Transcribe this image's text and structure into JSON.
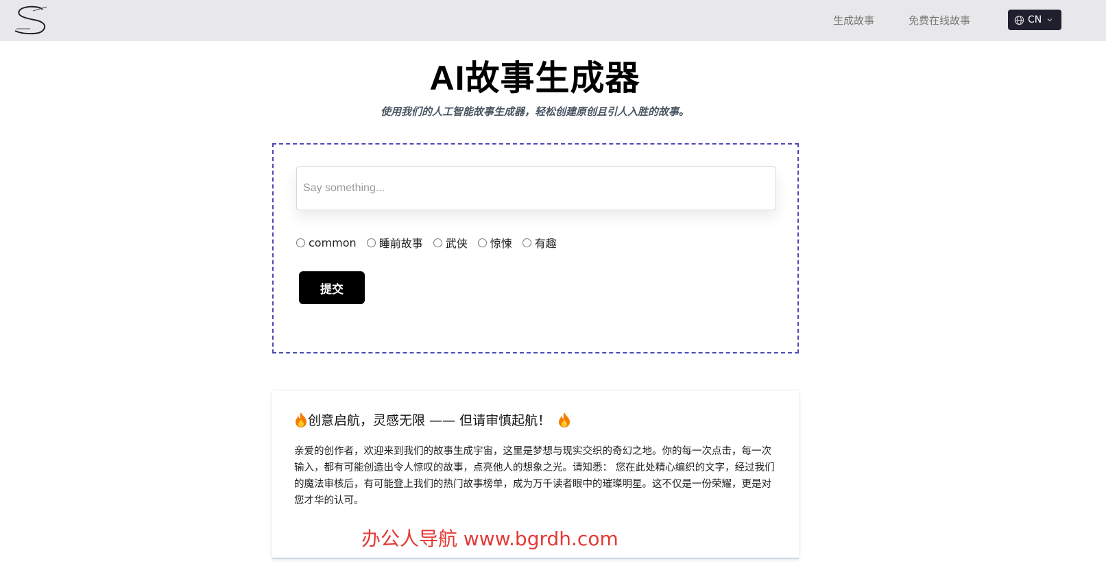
{
  "header": {
    "nav": [
      "生成故事",
      "免费在线故事"
    ],
    "language": "CN"
  },
  "hero": {
    "title": "AI故事生成器",
    "subtitle": "使用我们的人工智能故事生成器，轻松创建原创且引人入胜的故事。"
  },
  "form": {
    "placeholder": "Say something...",
    "value": "",
    "categories": [
      "common",
      "睡前故事",
      "武侠",
      "惊悚",
      "有趣"
    ],
    "submit_label": "提交"
  },
  "notice": {
    "heading": "创意启航，灵感无限 —— 但请审慎起航！",
    "body": "亲爱的创作者，欢迎来到我们的故事生成宇宙，这里是梦想与现实交织的奇幻之地。你的每一次点击，每一次输入，都有可能创造出令人惊叹的故事，点亮他人的想象之光。请知悉： 您在此处精心编织的文字，经过我们的魔法审核后，有可能登上我们的热门故事榜单，成为万千读者眼中的璀璨明星。这不仅是一份荣耀，更是对您才华的认可。",
    "watermark": "办公人导航 www.bgrdh.com"
  },
  "icons": {
    "logo": "s-logo-icon",
    "language": "globe-icon",
    "dropdown": "chevron-down-icon",
    "heading_decor": "fire-icon"
  },
  "colors": {
    "header_bg": "#e8e8ea",
    "lang_button_bg": "#1f1f2e",
    "form_border": "#4b49b8",
    "submit_bg": "#000000",
    "watermark": "#e53935"
  }
}
